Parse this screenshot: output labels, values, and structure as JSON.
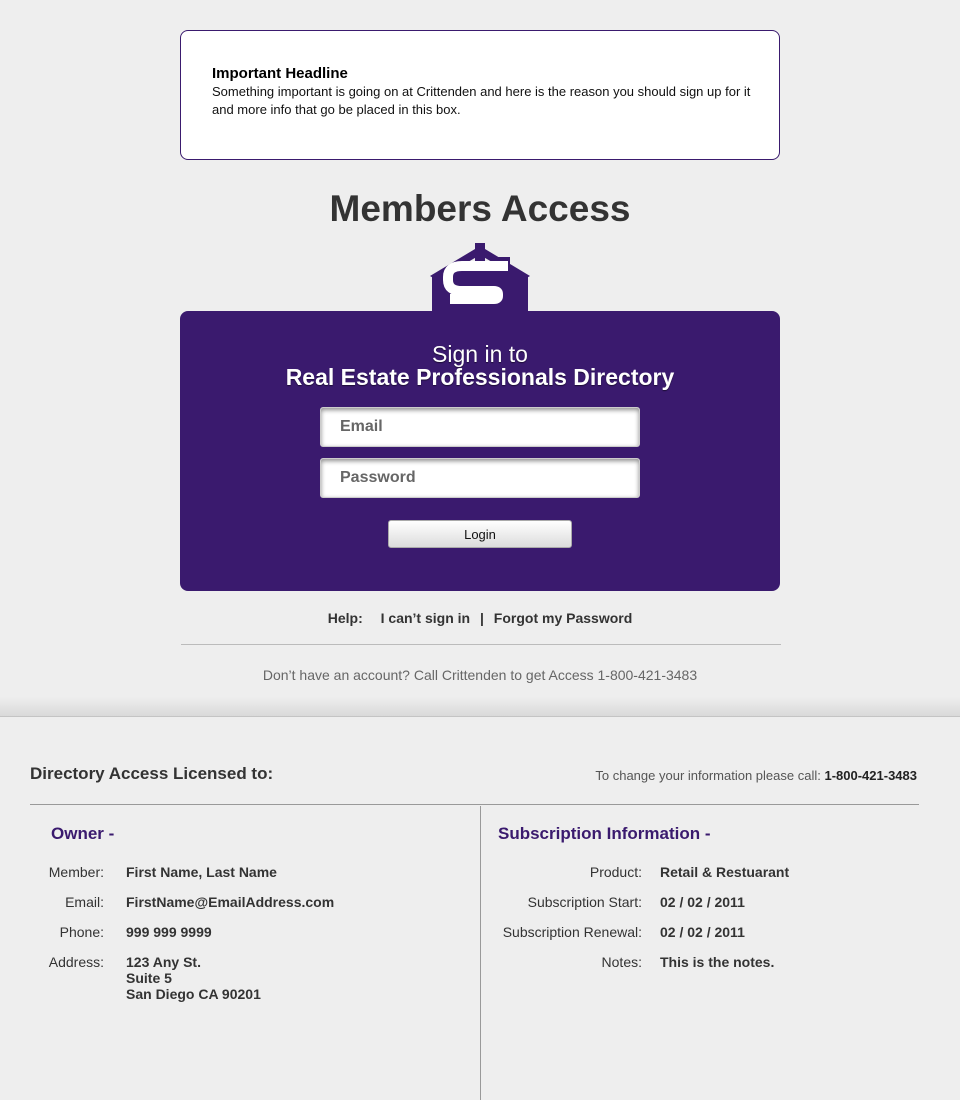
{
  "notice": {
    "headline": "Important Headline",
    "body": "Something important is going on at Crittenden and here is the reason you should sign up for it and more info that go be placed in this box."
  },
  "members_title": "Members Access",
  "colors": {
    "brand_purple": "#3a1a6e",
    "background": "#eeeeee"
  },
  "logo_icon": "house-dollar-icon",
  "signin": {
    "line1": "Sign in to",
    "line2": "Real Estate Professionals Directory",
    "email_placeholder": "Email",
    "password_placeholder": "Password",
    "login_label": "Login"
  },
  "help": {
    "label": "Help:",
    "cant_sign_in": "I can’t sign in",
    "separator": "|",
    "forgot_password": "Forgot my Password"
  },
  "no_account_text": "Don’t have an account? Call Crittenden to get Access 1-800-421-3483",
  "license": {
    "title": "Directory Access Licensed to:",
    "change_text": "To change your information please call:",
    "change_phone": "1-800-421-3483"
  },
  "owner": {
    "heading": "Owner -",
    "member_label": "Member:",
    "member_value": "First Name, Last Name",
    "email_label": "Email:",
    "email_value": "FirstName@EmailAddress.com",
    "phone_label": "Phone:",
    "phone_value": "999 999 9999",
    "address_label": "Address:",
    "address_line1": "123 Any St.",
    "address_line2": "Suite 5",
    "address_line3": "San Diego CA 90201"
  },
  "subscription": {
    "heading": "Subscription Information -",
    "product_label": "Product:",
    "product_value": "Retail & Restuarant",
    "start_label": "Subscription Start:",
    "start_value": "02 / 02 / 2011",
    "renewal_label": "Subscription Renewal:",
    "renewal_value": "02 / 02 / 2011",
    "notes_label": "Notes:",
    "notes_value": "This is the notes."
  }
}
